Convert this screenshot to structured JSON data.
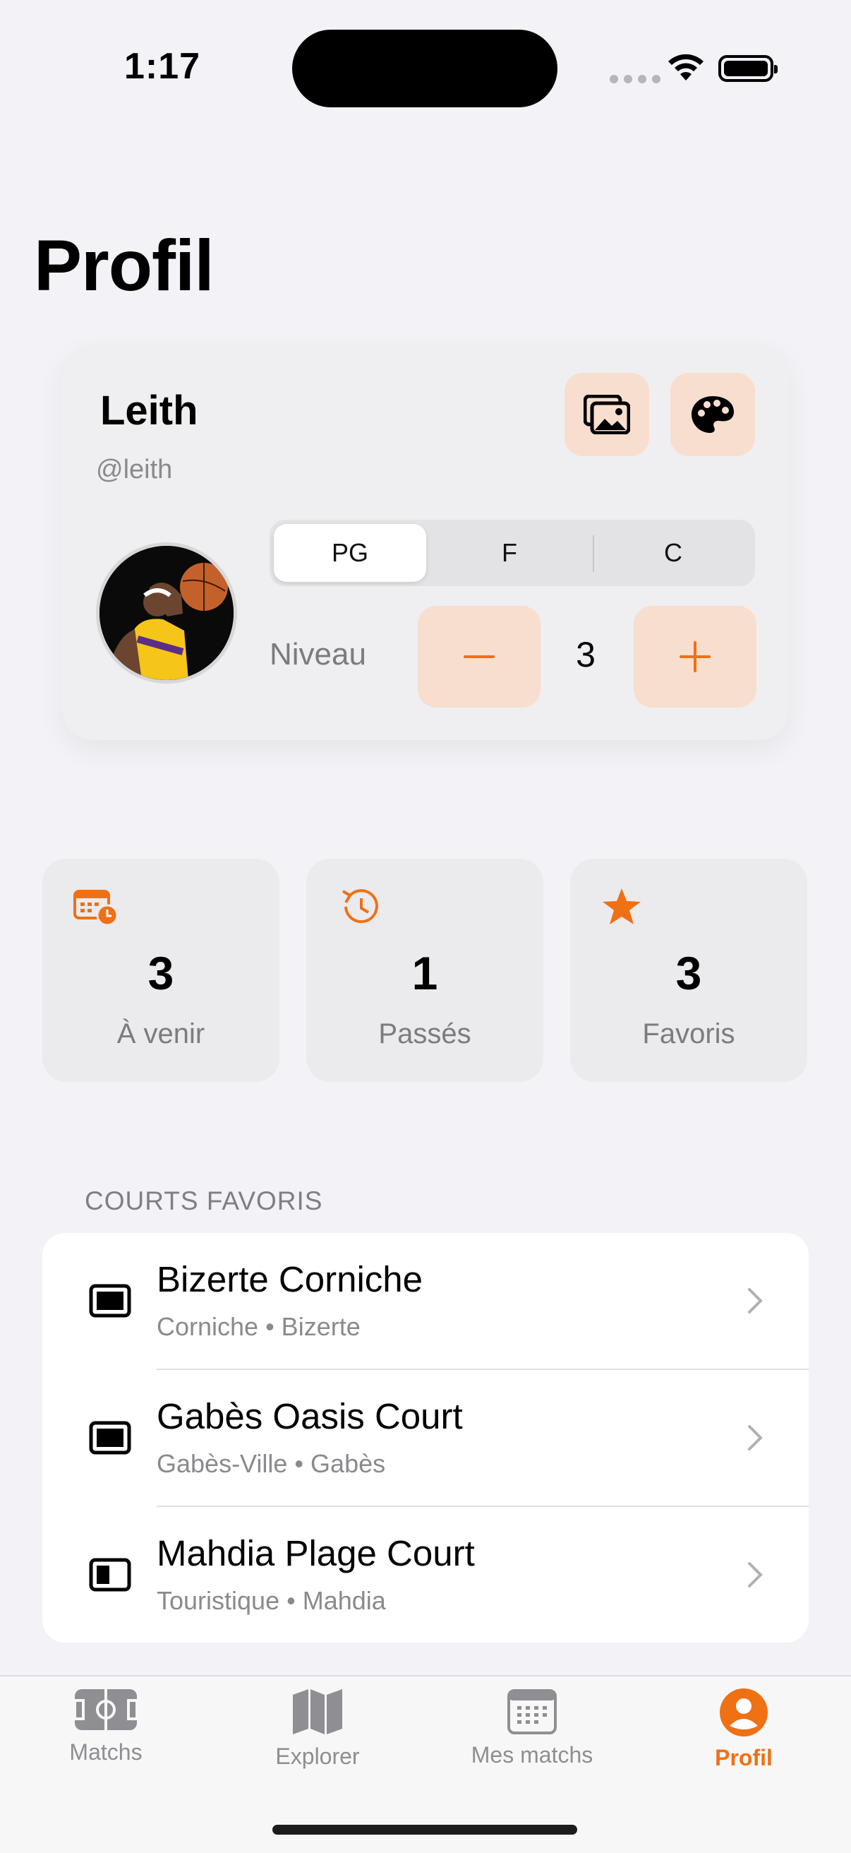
{
  "status_bar": {
    "time": "1:17"
  },
  "page": {
    "title": "Profil"
  },
  "profile": {
    "name": "Leith",
    "handle": "@leith",
    "positions": [
      "PG",
      "F",
      "C"
    ],
    "selected_position": "PG",
    "niveau_label": "Niveau",
    "niveau_value": "3",
    "photo_button_icon": "photo-gallery-icon",
    "theme_button_icon": "palette-icon"
  },
  "stats": [
    {
      "value": "3",
      "label": "À venir",
      "icon": "calendar-clock-icon"
    },
    {
      "value": "1",
      "label": "Passés",
      "icon": "history-icon"
    },
    {
      "value": "3",
      "label": "Favoris",
      "icon": "star-icon"
    }
  ],
  "favorites": {
    "header": "COURTS FAVORIS",
    "items": [
      {
        "title": "Bizerte Corniche",
        "subtitle": "Corniche • Bizerte",
        "icon": "court-full-icon"
      },
      {
        "title": "Gabès Oasis Court",
        "subtitle": "Gabès-Ville • Gabès",
        "icon": "court-full-icon"
      },
      {
        "title": "Mahdia Plage Court",
        "subtitle": "Touristique • Mahdia",
        "icon": "court-half-icon"
      }
    ]
  },
  "tabs": [
    {
      "label": "Matchs",
      "icon": "court-icon",
      "active": false
    },
    {
      "label": "Explorer",
      "icon": "map-icon",
      "active": false
    },
    {
      "label": "Mes matchs",
      "icon": "calendar-icon",
      "active": false
    },
    {
      "label": "Profil",
      "icon": "person-icon",
      "active": true
    }
  ],
  "colors": {
    "accent": "#f07014",
    "accent_soft": "#f8dece",
    "background": "#f2f2f7"
  }
}
